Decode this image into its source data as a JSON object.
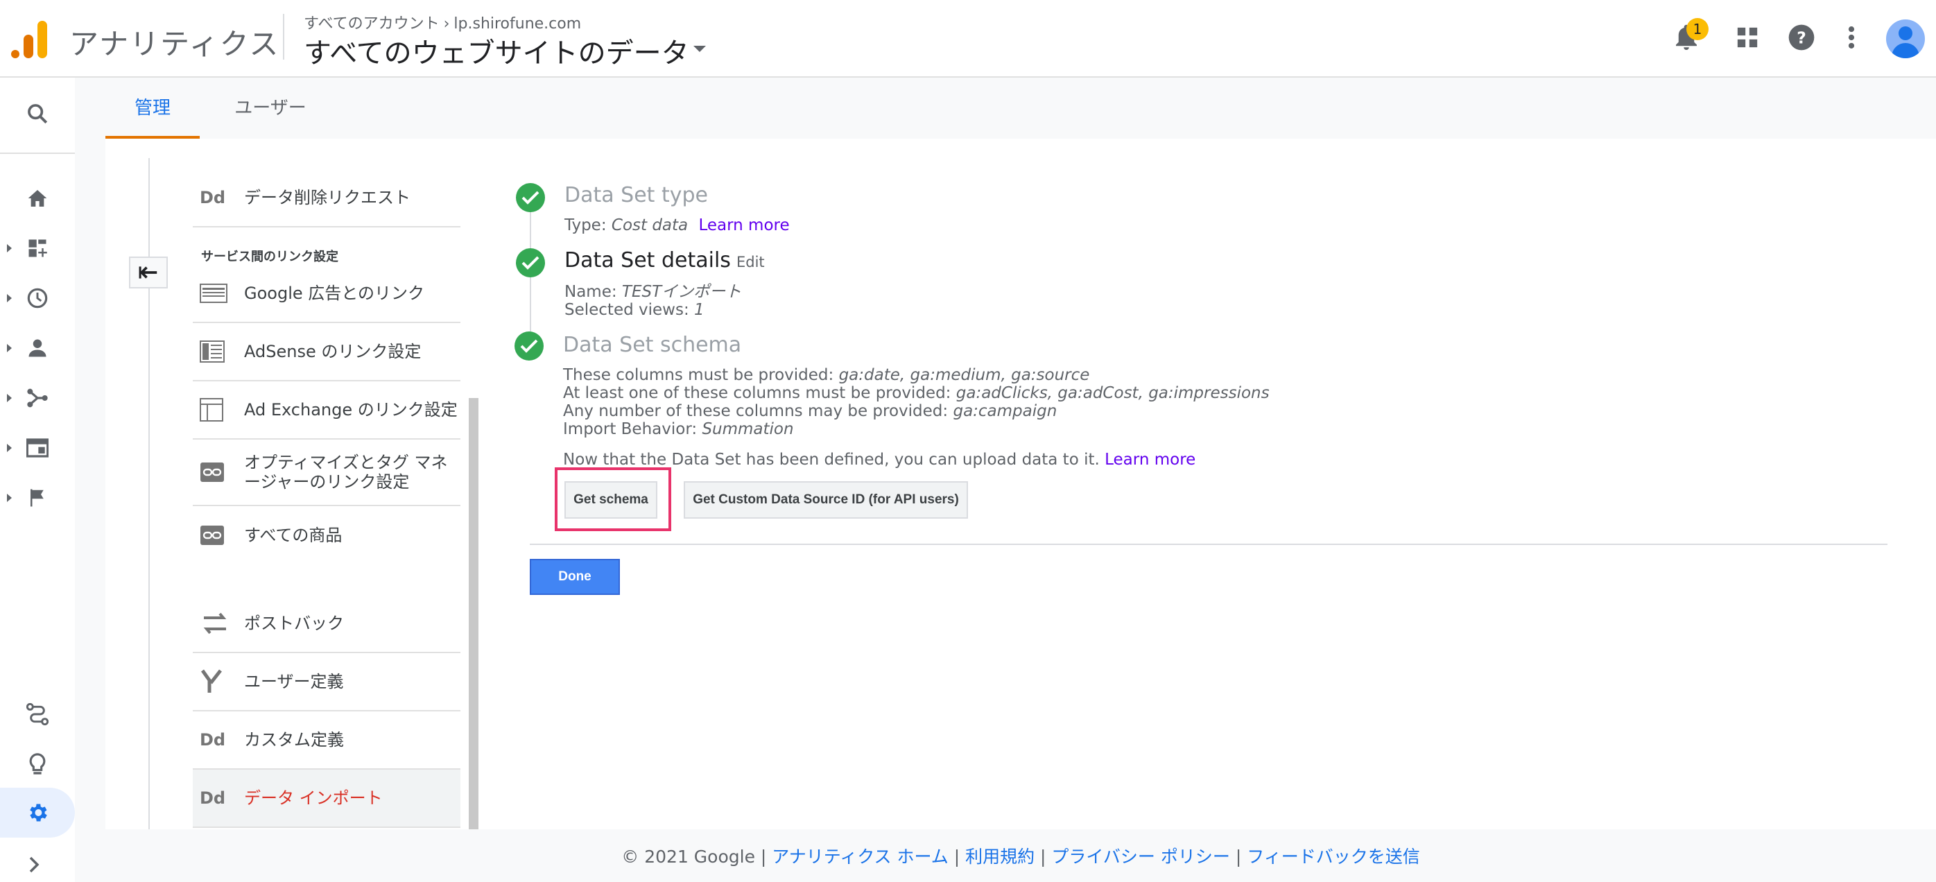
{
  "header": {
    "app_title": "アナリティクス",
    "account_breadcrumb": "すべてのアカウント",
    "property": "lp.shirofune.com",
    "view_title": "すべてのウェブサイトのデータ",
    "notification_count": "1"
  },
  "tabs": [
    {
      "label": "管理"
    },
    {
      "label": "ユーザー"
    }
  ],
  "sidebar": {
    "items": [
      {
        "label": "データ削除リクエスト",
        "icon": "dd-icon"
      },
      {
        "label": "Google 広告とのリンク",
        "icon": "google-ads-link-icon"
      },
      {
        "label": "AdSense のリンク設定",
        "icon": "adsense-link-icon"
      },
      {
        "label": "Ad Exchange のリンク設定",
        "icon": "ad-exchange-link-icon"
      },
      {
        "label": "オプティマイズとタグ マネージャーのリンク設定",
        "icon": "link-icon"
      },
      {
        "label": "すべての商品",
        "icon": "link-icon"
      },
      {
        "label": "ポストバック",
        "icon": "postback-icon"
      },
      {
        "label": "ユーザー定義",
        "icon": "user-definition-icon"
      },
      {
        "label": "カスタム定義",
        "icon": "dd-icon"
      },
      {
        "label": "データ インポート",
        "icon": "dd-icon"
      }
    ],
    "section_heading": "サービス間のリンク設定"
  },
  "steps": {
    "type": {
      "title": "Data Set type",
      "type_label": "Type:",
      "type_value": "Cost data",
      "learn_more": "Learn more"
    },
    "details": {
      "title": "Data Set details",
      "edit": "Edit",
      "name_label": "Name:",
      "name_value": "TESTインポート",
      "views_label": "Selected views:",
      "views_value": "1"
    },
    "schema": {
      "title": "Data Set schema",
      "required_label": "These columns must be provided:",
      "required_value": "ga:date, ga:medium, ga:source",
      "atleast_label": "At least one of these columns must be provided:",
      "atleast_value": "ga:adClicks, ga:adCost, ga:impressions",
      "optional_label": "Any number of these columns may be provided:",
      "optional_value": "ga:campaign",
      "behavior_label": "Import Behavior:",
      "behavior_value": "Summation",
      "upload_note": "Now that the Data Set has been defined, you can upload data to it.",
      "learn_more": "Learn more",
      "get_schema": "Get schema",
      "get_custom_id": "Get Custom Data Source ID (for API users)"
    }
  },
  "done_label": "Done",
  "footer": {
    "copyright": "© 2021 Google",
    "links": [
      "アナリティクス ホーム",
      "利用規約",
      "プライバシー ポリシー",
      "フィードバックを送信"
    ]
  },
  "colors": {
    "accent": "#1a73e8",
    "tab_indicator": "#e37400",
    "success": "#34a853",
    "active_nav": "#d93025",
    "highlight": "#e8336b",
    "link": "#6200ee"
  }
}
